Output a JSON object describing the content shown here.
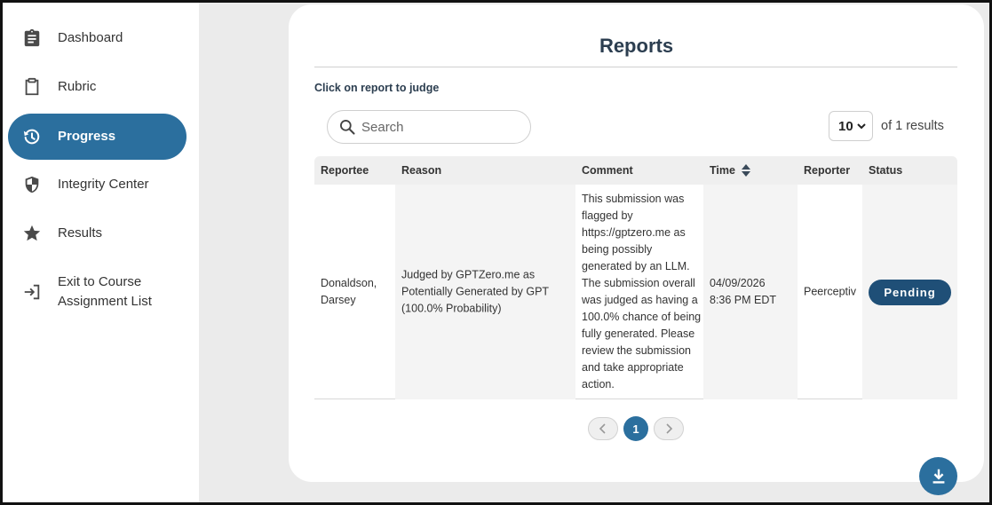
{
  "sidebar": {
    "items": [
      {
        "label": "Dashboard",
        "icon": "clipboard-list-icon"
      },
      {
        "label": "Rubric",
        "icon": "clipboard-icon"
      },
      {
        "label": "Progress",
        "icon": "history-icon",
        "active": true
      },
      {
        "label": "Integrity Center",
        "icon": "shield-icon"
      },
      {
        "label": "Results",
        "icon": "star-icon"
      },
      {
        "label_line1": "Exit to Course",
        "label_line2": "Assignment List",
        "icon": "exit-icon"
      }
    ]
  },
  "main": {
    "title": "Reports",
    "hint": "Click on report to judge",
    "search": {
      "placeholder": "Search",
      "icon": "search-icon"
    },
    "page_size": "10",
    "results_text": "of 1 results",
    "table": {
      "headers": [
        "Reportee",
        "Reason",
        "Comment",
        "Time",
        "Reporter",
        "Status"
      ],
      "rows": [
        {
          "reportee_line1": "Donaldson,",
          "reportee_line2": "Darsey",
          "reason": "Judged by GPTZero.me as Potentially Generated by GPT (100.0% Probability)",
          "comment": "This submission was flagged by https://gptzero.me as being possibly generated by an LLM. The submission overall was judged as having a 100.0% chance of being fully generated. Please review the submission and take appropriate action.",
          "time_line1": "04/09/2026",
          "time_line2": "8:36 PM EDT",
          "reporter": "Peerceptiv",
          "status": "Pending"
        }
      ]
    },
    "pagination": {
      "current": "1"
    }
  },
  "colors": {
    "accent": "#2b6f9e",
    "badge": "#1f4f77",
    "title": "#2c3e50",
    "background": "#ebebeb"
  }
}
